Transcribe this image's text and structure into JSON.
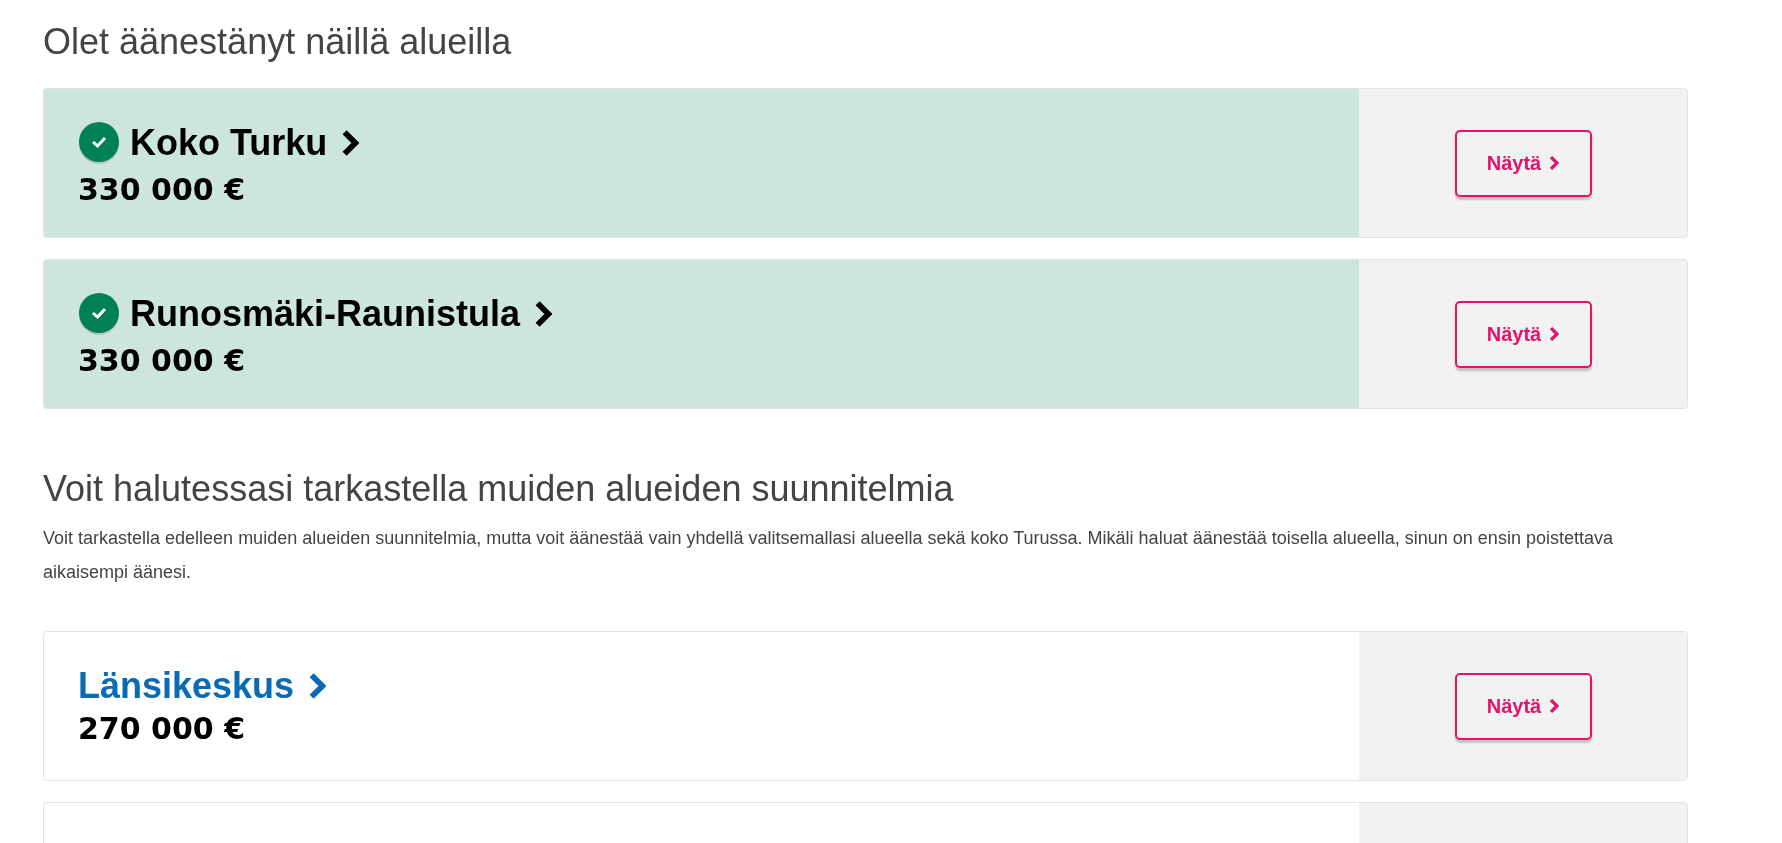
{
  "sections": [
    {
      "heading": "Olet äänestänyt näillä alueilla",
      "areas": [
        {
          "name": "Koko Turku",
          "amount": "330 000 €",
          "voted": true,
          "button": "Näytä"
        },
        {
          "name": "Runosmäki-Raunistula",
          "amount": "330 000 €",
          "voted": true,
          "button": "Näytä"
        }
      ]
    },
    {
      "heading": "Voit halutessasi tarkastella muiden alueiden suunnitelmia",
      "description": "Voit tarkastella edelleen muiden alueiden suunnitelmia, mutta voit äänestää vain yhdellä valitsemallasi alueella sekä koko Turussa. Mikäli haluat äänestää toisella alueella, sinun on ensin poistettava aikaisempi äänesi.",
      "areas": [
        {
          "name": "Länsikeskus",
          "amount": "270 000 €",
          "voted": false,
          "button": "Näytä"
        }
      ],
      "more_below": true
    }
  ]
}
